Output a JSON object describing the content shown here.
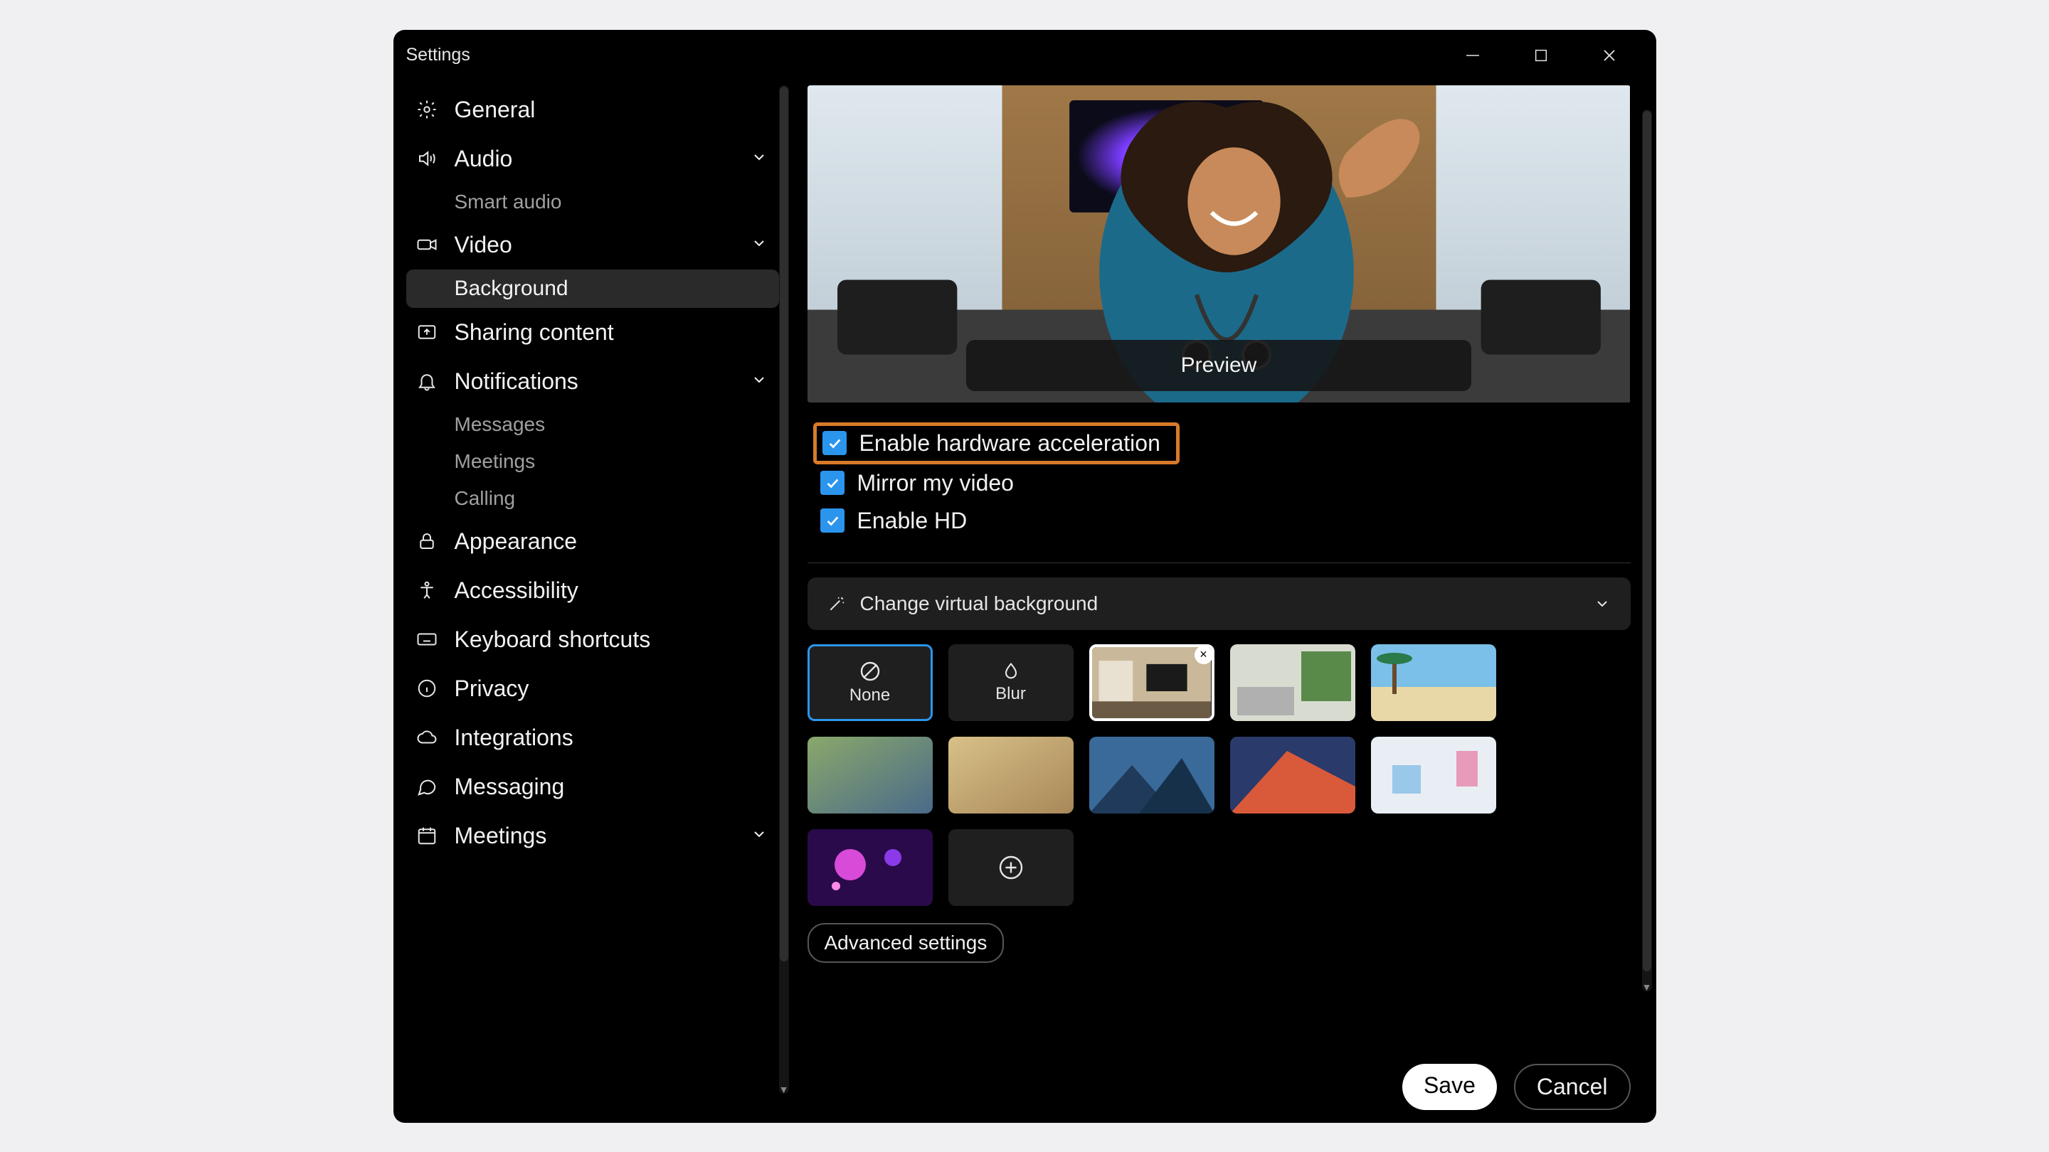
{
  "window": {
    "title": "Settings"
  },
  "sidebar": {
    "items": [
      {
        "label": "General",
        "icon": "gear"
      },
      {
        "label": "Audio",
        "icon": "speaker",
        "chev": true,
        "subs": [
          {
            "label": "Smart audio"
          }
        ]
      },
      {
        "label": "Video",
        "icon": "camera",
        "chev": true,
        "subs": [
          {
            "label": "Background",
            "active": true
          }
        ]
      },
      {
        "label": "Sharing content",
        "icon": "share"
      },
      {
        "label": "Notifications",
        "icon": "bell",
        "chev": true,
        "subs": [
          {
            "label": "Messages"
          },
          {
            "label": "Meetings"
          },
          {
            "label": "Calling"
          }
        ]
      },
      {
        "label": "Appearance",
        "icon": "palette"
      },
      {
        "label": "Accessibility",
        "icon": "access"
      },
      {
        "label": "Keyboard shortcuts",
        "icon": "keyboard"
      },
      {
        "label": "Privacy",
        "icon": "info"
      },
      {
        "label": "Integrations",
        "icon": "cloud"
      },
      {
        "label": "Messaging",
        "icon": "chat"
      },
      {
        "label": "Meetings",
        "icon": "calendar",
        "chev": true
      }
    ]
  },
  "main": {
    "preview_label": "Preview",
    "checks": [
      {
        "label": "Enable hardware acceleration",
        "checked": true,
        "highlight": true
      },
      {
        "label": "Mirror my video",
        "checked": true
      },
      {
        "label": "Enable HD",
        "checked": true
      }
    ],
    "accordion_label": "Change virtual background",
    "bg_none": "None",
    "bg_blur": "Blur",
    "advanced_label": "Advanced settings",
    "save_label": "Save",
    "cancel_label": "Cancel"
  }
}
